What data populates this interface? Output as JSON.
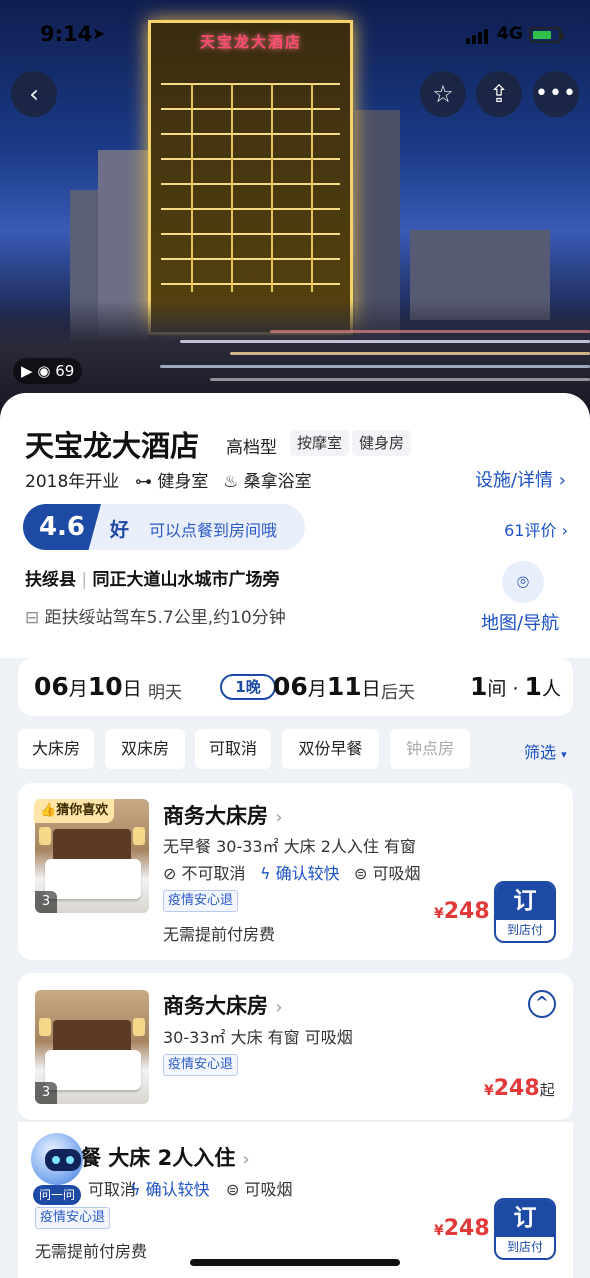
{
  "status_bar": {
    "time": "9:14",
    "network": "4G"
  },
  "hero": {
    "sign_text": "天宝龙大酒店",
    "media_count": "69"
  },
  "hotel": {
    "name": "天宝龙大酒店",
    "class": "高档型",
    "tags": [
      "按摩室",
      "健身房"
    ],
    "opened": "2018年开业",
    "facility_1": "健身室",
    "facility_2": "桑拿浴室",
    "details_link": "设施/详情",
    "rating": "4.6",
    "rating_word": "好",
    "rating_note": "可以点餐到房间哦",
    "reviews": "61评价",
    "district": "扶绥县",
    "street": "同正大道山水城市广场旁",
    "distance": "距扶绥站驾车5.7公里,约10分钟",
    "map_label": "地图/导航"
  },
  "dates": {
    "checkin_month": "06",
    "checkin_day": "10",
    "checkin_rel": "明天",
    "nights": "1晚",
    "checkout_month": "06",
    "checkout_day": "11",
    "checkout_rel": "后天",
    "rooms": "1",
    "guests": "1"
  },
  "filters": [
    "大床房",
    "双床房",
    "可取消",
    "双份早餐",
    "钟点房"
  ],
  "filter_sort": "筛选",
  "rooms": [
    {
      "badge": "猜你喜欢",
      "name": "商务大床房",
      "line": "无早餐 30-33㎡ 大床 2人入住 有窗",
      "cancel": "不可取消",
      "confirm": "确认较快",
      "smoke": "可吸烟",
      "safe": "疫情安心退",
      "nopay": "无需提前付房费",
      "price": "248",
      "book": "订",
      "book_sub": "到店付",
      "photos": "3"
    },
    {
      "name": "商务大床房",
      "line": "30-33㎡ 大床 有窗 可吸烟",
      "safe": "疫情安心退",
      "price": "248",
      "price_suffix": "起",
      "photos": "3"
    },
    {
      "name": "餐 大床 2人入住",
      "cancel": "可取消",
      "confirm": "确认较快",
      "smoke": "可吸烟",
      "safe": "疫情安心退",
      "nopay": "无需提前付房费",
      "price": "248",
      "book": "订",
      "book_sub": "到店付"
    }
  ],
  "assistant_label": "问一问",
  "colors": {
    "brand_blue": "#1d4aa5",
    "link_blue": "#1c52c4",
    "price_red": "#e23a3a",
    "badge_yellow": "#ffe6a8"
  }
}
